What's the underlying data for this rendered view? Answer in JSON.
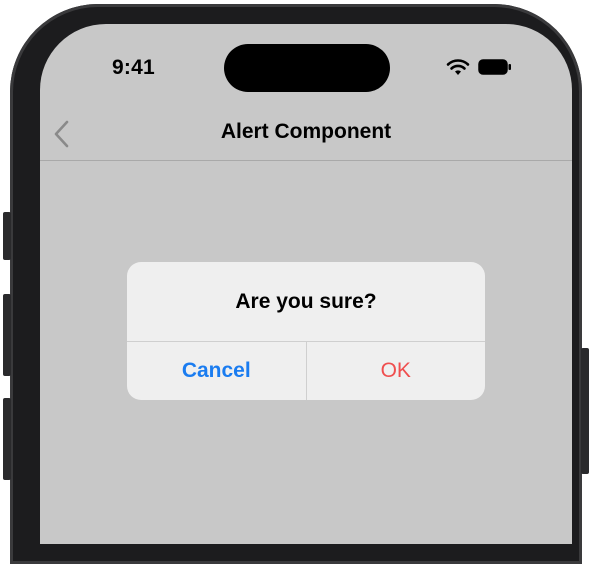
{
  "status_bar": {
    "time": "9:41",
    "icons": [
      "wifi-icon",
      "battery-icon"
    ]
  },
  "nav": {
    "title": "Alert Component",
    "back_icon": "chevron-left-icon"
  },
  "alert": {
    "title": "Are you sure?",
    "cancel_label": "Cancel",
    "ok_label": "OK"
  },
  "colors": {
    "screen_background": "#c8c8c8",
    "alert_background": "#efefef",
    "cancel": "#1a7cf0",
    "ok": "#ef4e4e",
    "device_frame": "#1c1c1e"
  }
}
